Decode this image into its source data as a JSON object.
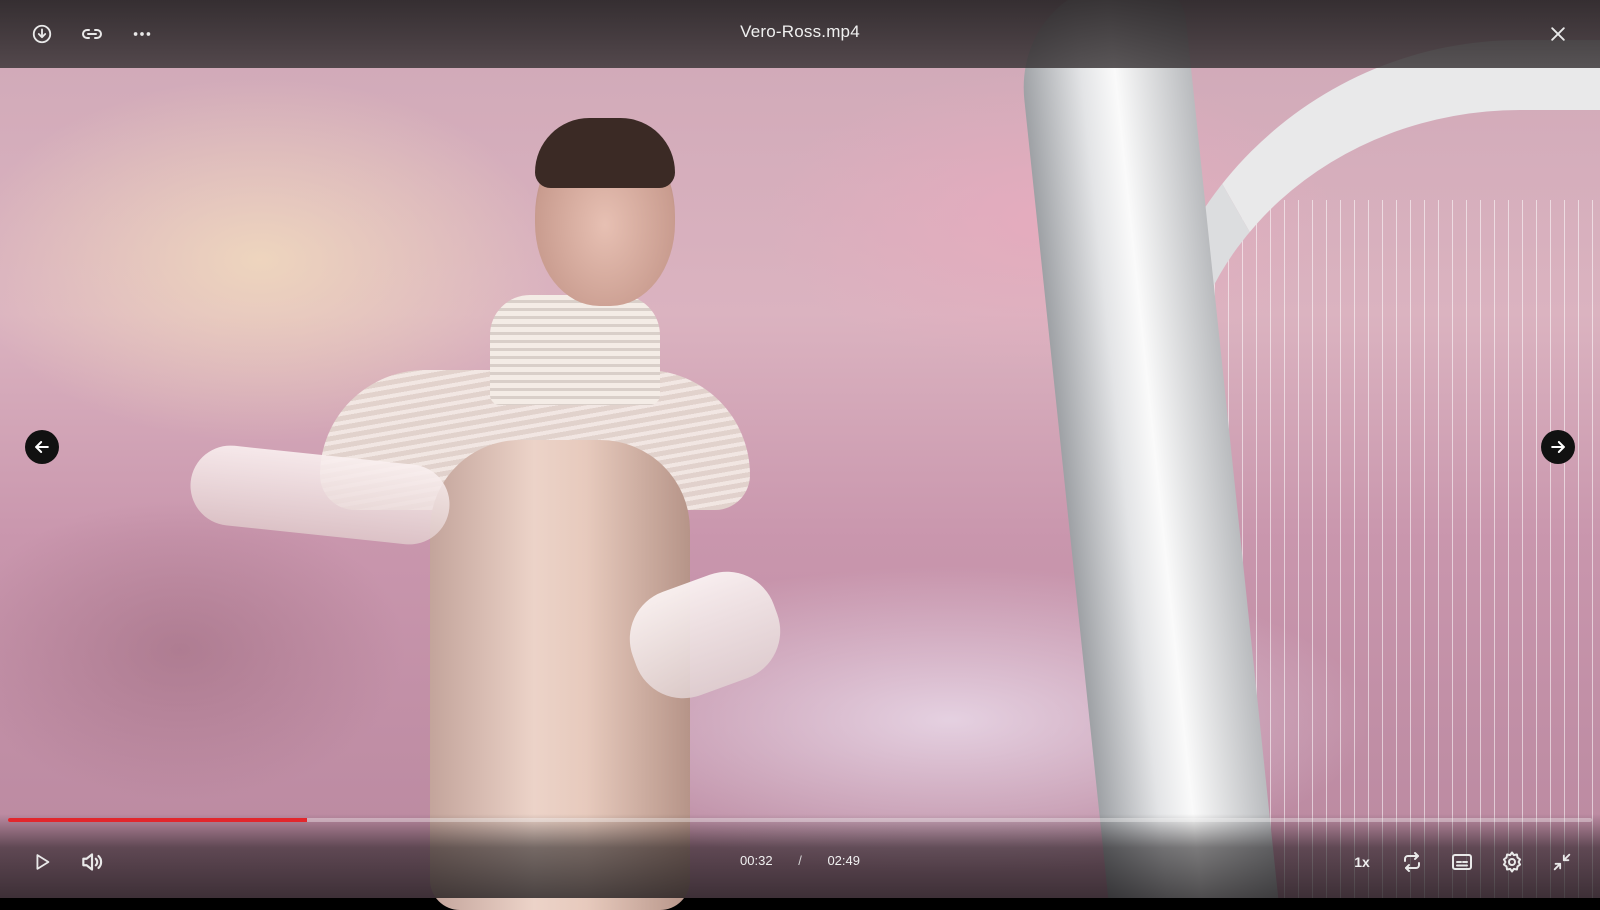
{
  "window": {
    "title": "Vero-Ross.mp4"
  },
  "toolbar": {
    "icons": [
      "download-icon",
      "link-icon",
      "more-icon",
      "close-icon"
    ]
  },
  "navigation": {
    "prev_icon": "arrow-left-icon",
    "next_icon": "arrow-right-icon"
  },
  "player": {
    "current_time": "00:32",
    "separator": "/",
    "duration": "02:49",
    "progress_fraction": 0.189,
    "speed": "1x",
    "accent_color": "#e2262c",
    "icons": [
      "play-icon",
      "volume-icon",
      "loop-icon",
      "subtitles-icon",
      "settings-icon",
      "exit-fullscreen-icon"
    ]
  }
}
